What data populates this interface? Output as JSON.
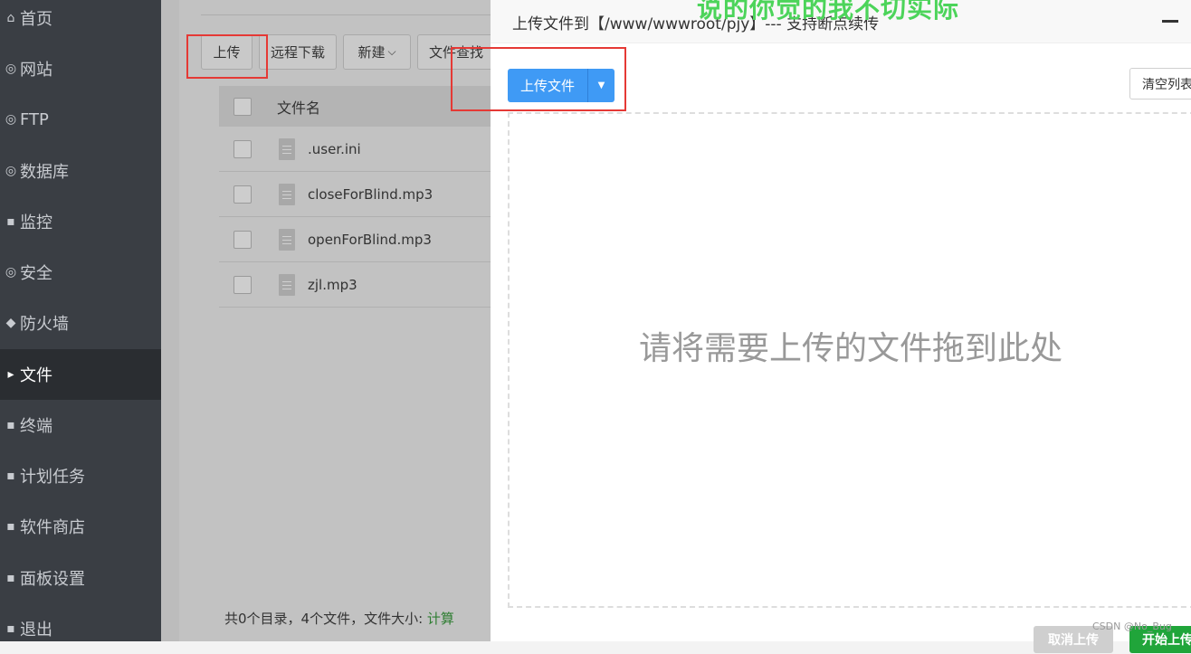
{
  "sidebar": {
    "items": [
      {
        "label": "首页",
        "icon": "home-icon",
        "glyph": "⌂"
      },
      {
        "label": "网站",
        "icon": "globe-icon",
        "glyph": "◎"
      },
      {
        "label": "FTP",
        "icon": "ftp-icon",
        "glyph": "◎"
      },
      {
        "label": "数据库",
        "icon": "database-icon",
        "glyph": "◎"
      },
      {
        "label": "监控",
        "icon": "monitor-icon",
        "glyph": "▪"
      },
      {
        "label": "安全",
        "icon": "shield-icon",
        "glyph": "◎"
      },
      {
        "label": "防火墙",
        "icon": "firewall-icon",
        "glyph": "◆"
      },
      {
        "label": "文件",
        "icon": "folder-icon",
        "glyph": "▸"
      },
      {
        "label": "终端",
        "icon": "terminal-icon",
        "glyph": "▪"
      },
      {
        "label": "计划任务",
        "icon": "calendar-icon",
        "glyph": "▪"
      },
      {
        "label": "软件商店",
        "icon": "store-icon",
        "glyph": "▪"
      },
      {
        "label": "面板设置",
        "icon": "settings-icon",
        "glyph": "▪"
      },
      {
        "label": "退出",
        "icon": "logout-icon",
        "glyph": "▪"
      }
    ],
    "active": "文件"
  },
  "toolbar": {
    "upload": "上传",
    "remote_download": "远程下载",
    "new": "新建",
    "new_caret": "⌵",
    "file_search": "文件查找"
  },
  "table": {
    "header_name": "文件名",
    "rows": [
      {
        "name": ".user.ini"
      },
      {
        "name": "closeForBlind.mp3"
      },
      {
        "name": "openForBlind.mp3"
      },
      {
        "name": "zjl.mp3"
      }
    ]
  },
  "footer": {
    "summary": "共0个目录，4个文件，文件大小: ",
    "calc_link": "计算"
  },
  "modal": {
    "title": "上传文件到【/www/wwwroot/pjy】--- 支持断点续传",
    "upload_button": "上传文件",
    "clear_button": "清空列表",
    "drop_hint": "请将需要上传的文件拖到此处",
    "cancel_button": "取消上传",
    "start_button": "开始上传"
  },
  "overlay_text": "说的你觉的我不切实际",
  "watermark": "CSDN @No_Bug",
  "colors": {
    "sidebar_bg": "#3a3e44",
    "primary_blue": "#3f9af5",
    "start_green": "#20a53a",
    "annotation_red": "#e53935"
  }
}
